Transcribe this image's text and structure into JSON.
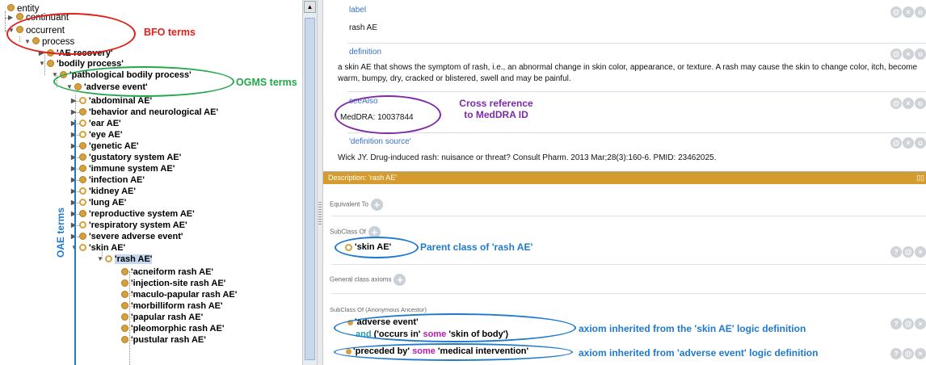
{
  "tree": {
    "nodes": [
      {
        "label": "entity",
        "bold": false,
        "icon": "dot-filled"
      },
      {
        "label": "continuant",
        "bold": false,
        "icon": "dot-filled"
      },
      {
        "label": "occurrent",
        "bold": false,
        "icon": "dot-filled"
      },
      {
        "label": "process",
        "bold": false,
        "icon": "dot-filled"
      },
      {
        "label": "'AE recovery'",
        "bold": true,
        "icon": "dot-filled"
      },
      {
        "label": "'bodily process'",
        "bold": true,
        "icon": "dot-filled"
      },
      {
        "label": "'pathological bodily process'",
        "bold": true,
        "icon": "dot-filled"
      },
      {
        "label": "'adverse event'",
        "bold": true,
        "icon": "dot-filled"
      },
      {
        "label": "'abdominal AE'",
        "bold": true,
        "icon": "dot-hollow"
      },
      {
        "label": "'behavior and neurological AE'",
        "bold": true,
        "icon": "dot-filled"
      },
      {
        "label": "'ear AE'",
        "bold": true,
        "icon": "dot-hollow"
      },
      {
        "label": "'eye AE'",
        "bold": true,
        "icon": "dot-hollow"
      },
      {
        "label": "'genetic AE'",
        "bold": true,
        "icon": "dot-filled"
      },
      {
        "label": "'gustatory system AE'",
        "bold": true,
        "icon": "dot-filled"
      },
      {
        "label": "'immune system AE'",
        "bold": true,
        "icon": "dot-filled"
      },
      {
        "label": "'infection AE'",
        "bold": true,
        "icon": "dot-filled"
      },
      {
        "label": "'kidney AE'",
        "bold": true,
        "icon": "dot-hollow"
      },
      {
        "label": "'lung AE'",
        "bold": true,
        "icon": "dot-hollow"
      },
      {
        "label": "'reproductive system AE'",
        "bold": true,
        "icon": "dot-filled"
      },
      {
        "label": "'respiratory system AE'",
        "bold": true,
        "icon": "dot-hollow"
      },
      {
        "label": "'severe adverse event'",
        "bold": true,
        "icon": "dot-filled"
      },
      {
        "label": "'skin AE'",
        "bold": true,
        "icon": "dot-hollow"
      },
      {
        "label": "'rash AE'",
        "bold": true,
        "icon": "dot-hollow",
        "selected": true
      },
      {
        "label": "'acneiform rash AE'",
        "bold": true,
        "icon": "dot-filled"
      },
      {
        "label": "'injection-site rash AE'",
        "bold": true,
        "icon": "dot-filled"
      },
      {
        "label": "'maculo-papular rash AE'",
        "bold": true,
        "icon": "dot-filled"
      },
      {
        "label": "'morbilliform rash AE'",
        "bold": true,
        "icon": "dot-filled"
      },
      {
        "label": "'papular rash AE'",
        "bold": true,
        "icon": "dot-filled"
      },
      {
        "label": "'pleomorphic rash AE'",
        "bold": true,
        "icon": "dot-filled"
      },
      {
        "label": "'pustular rash AE'",
        "bold": true,
        "icon": "dot-filled"
      }
    ]
  },
  "annotations": [
    {
      "property": "label",
      "value": "rash AE"
    },
    {
      "property": "definition",
      "value": "a skin AE that shows the symptom of rash, i.e., an abnormal change in skin color, appearance, or texture. A rash may cause the skin to change color, itch, become warm, bumpy, dry, cracked or blistered, swell and may be painful."
    },
    {
      "property": "seeAlso",
      "value": "MedDRA: 10037844"
    },
    {
      "property": "'definition source'",
      "value": "Wick JY. Drug-induced rash: nuisance or threat? Consult Pharm. 2013 Mar;28(3):160-6. PMID: 23462025."
    }
  ],
  "annotation_buttons": [
    "@",
    "×",
    "o"
  ],
  "axiom_buttons": [
    "?",
    "@",
    "×"
  ],
  "description": {
    "title": "Description: 'rash AE'",
    "header_ctrl": "▯▯",
    "equivalent_to": "Equivalent To",
    "subclass_of": "SubClass Of",
    "subclass_value": "'skin AE'",
    "general_axioms": "General class axioms",
    "anon_ancestor": "SubClass Of (Anonymous Ancestor)",
    "ancestor1_line1": "'adverse event'",
    "ancestor1_and": "and",
    "ancestor1_prop": "('occurs in'",
    "ancestor1_some": "some",
    "ancestor1_filler": "'skin of body')",
    "ancestor2_prop": "'preceded by'",
    "ancestor2_some": "some",
    "ancestor2_filler": "'medical intervention'"
  },
  "overlay": {
    "bfo": "BFO terms",
    "ogms": "OGMS terms",
    "oae": "OAE terms",
    "cross_ref_line1": "Cross reference",
    "cross_ref_line2": "to MedDRA ID",
    "parent_class": "Parent class of 'rash AE'",
    "axiom1": "axiom inherited from the 'skin AE' logic definition",
    "axiom2": "axiom inherited from 'adverse event' logic definition"
  },
  "colors": {
    "red": "#e0201b",
    "green": "#1fa84a",
    "purple": "#7d2aa6",
    "blue": "#1f7acc",
    "description_header": "#d49b2e"
  }
}
